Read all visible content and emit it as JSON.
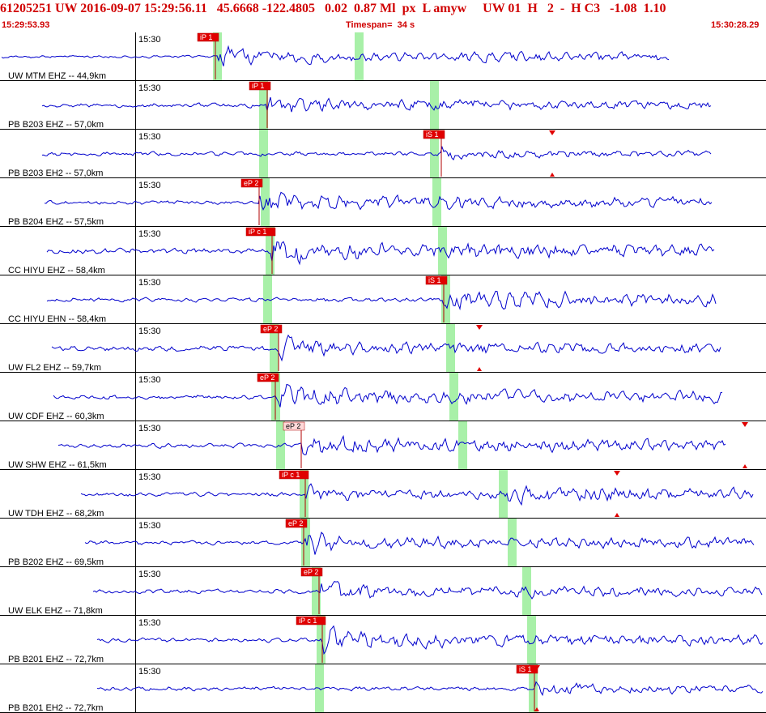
{
  "header": {
    "event_line": "61205251 UW 2016-09-07 15:29:56.11   45.6668 -122.4805   0.02  0.87 Ml  px  L amyw     UW 01  H   2  -  H C3   -1.08  1.10",
    "start_time": "15:29:53.93",
    "timespan": "Timespan=  34 s",
    "end_time": "15:30:28.29"
  },
  "colors": {
    "header_text": "#d00000",
    "trace": "#0000cc",
    "pick_box": "#e00000",
    "pick_box_emergent": "#ffd8d8",
    "window_band": "#a8f0a8",
    "separator": "#000000"
  },
  "traces": [
    {
      "time_label": "15:30",
      "station": "UW MTM EHZ -- 44,9km",
      "picks": [
        {
          "text": "iP 1"
        }
      ],
      "arrival": true
    },
    {
      "time_label": "15:30",
      "station": "PB B203 EHZ -- 57,0km",
      "picks": [
        {
          "text": "iP 1"
        }
      ],
      "arrival": false
    },
    {
      "time_label": "15:30",
      "station": "PB B203 EH2 -- 57,0km",
      "picks": [
        {
          "text": "iS 1"
        }
      ],
      "arrival": false
    },
    {
      "time_label": "15:30",
      "station": "PB B204 EHZ -- 57,5km",
      "picks": [
        {
          "text": "eP 2"
        }
      ],
      "arrival": false
    },
    {
      "time_label": "15:30",
      "station": "CC HIYU EHZ -- 58,4km",
      "picks": [
        {
          "text": "iP c 1"
        }
      ],
      "arrival": false
    },
    {
      "time_label": "15:30",
      "station": "CC HIYU EHN -- 58,4km",
      "picks": [
        {
          "text": "iS 1"
        }
      ],
      "arrival": false
    },
    {
      "time_label": "15:30",
      "station": "UW FL2 EHZ -- 59,7km",
      "picks": [
        {
          "text": "eP 2"
        }
      ],
      "arrival": false
    },
    {
      "time_label": "15:30",
      "station": "UW CDF EHZ -- 60,3km",
      "picks": [
        {
          "text": "eP 2"
        }
      ],
      "arrival": false
    },
    {
      "time_label": "15:30",
      "station": "UW SHW EHZ -- 61,5km",
      "picks": [
        {
          "text": "eP 2"
        }
      ],
      "arrival": true
    },
    {
      "time_label": "15:30",
      "station": "UW TDH EHZ -- 68,2km",
      "picks": [
        {
          "text": "iP c 1"
        }
      ],
      "arrival": false
    },
    {
      "time_label": "15:30",
      "station": "PB B202 EHZ -- 69,5km",
      "picks": [
        {
          "text": "eP 2"
        }
      ],
      "arrival": true
    },
    {
      "time_label": "15:30",
      "station": "UW ELK EHZ -- 71,8km",
      "picks": [
        {
          "text": "eP 2"
        }
      ],
      "arrival": true
    },
    {
      "time_label": "15:30",
      "station": "PB B201 EHZ -- 72,7km",
      "picks": [
        {
          "text": "iP c 1"
        }
      ],
      "arrival": false
    },
    {
      "time_label": "15:30",
      "station": "PB B201 EH2 -- 72,7km",
      "picks": [
        {
          "text": "iS 1"
        }
      ],
      "arrival": false
    }
  ]
}
